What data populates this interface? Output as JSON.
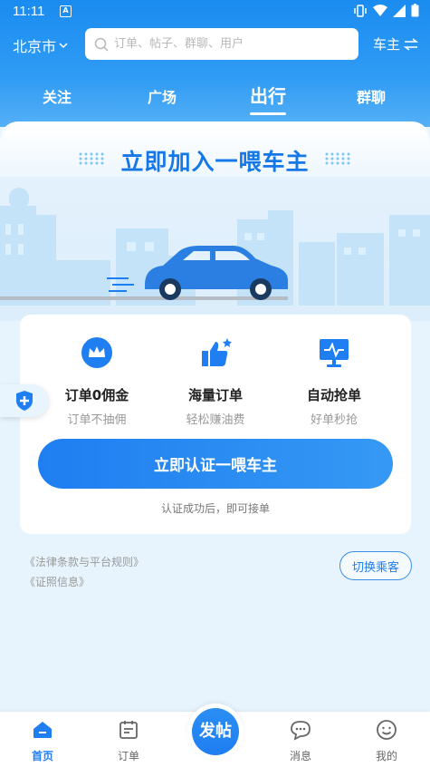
{
  "status_bar": {
    "time": "11:11",
    "notification_badge": "A"
  },
  "header": {
    "city": "北京市",
    "search_placeholder": "订单、帖子、群聊、用户",
    "role_switch_label": "车主",
    "tabs": [
      {
        "label": "关注",
        "active": false
      },
      {
        "label": "广场",
        "active": false
      },
      {
        "label": "出行",
        "active": true
      },
      {
        "label": "群聊",
        "active": false
      }
    ]
  },
  "banner": {
    "title": "立即加入一喂车主"
  },
  "features": [
    {
      "icon": "crown-icon",
      "title": "订单0佣金",
      "subtitle": "订单不抽佣"
    },
    {
      "icon": "thumbs-up-icon",
      "title": "海量订单",
      "subtitle": "轻松赚油费"
    },
    {
      "icon": "monitor-icon",
      "title": "自动抢单",
      "subtitle": "好单秒抢"
    }
  ],
  "cta": {
    "label": "立即认证一喂车主",
    "note": "认证成功后，即可接单"
  },
  "links": {
    "legal": "《法律条款与平台规则》",
    "license": "《证照信息》"
  },
  "switch_passenger_label": "切换乘客",
  "bottom_nav": {
    "items": [
      {
        "label": "首页",
        "icon": "home-icon",
        "active": true
      },
      {
        "label": "订单",
        "icon": "calendar-icon",
        "active": false
      },
      {
        "label": "消息",
        "icon": "chat-icon",
        "active": false
      },
      {
        "label": "我的",
        "icon": "smile-icon",
        "active": false
      }
    ],
    "post_label": "发帖"
  },
  "colors": {
    "primary": "#1f7ef1",
    "header_top": "#1a8cf0",
    "background": "#e8f4fd"
  }
}
